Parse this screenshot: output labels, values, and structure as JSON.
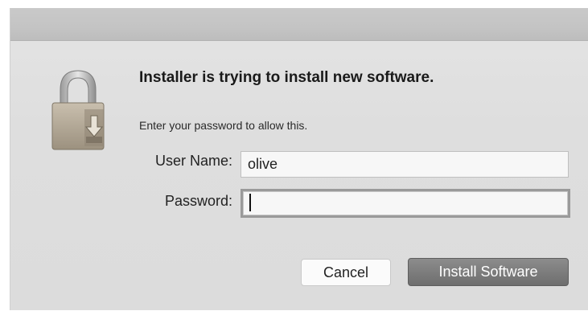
{
  "dialog": {
    "title": "Installer is trying to install new software.",
    "message": "Enter your password to allow this."
  },
  "icons": {
    "lock": "padlock-icon"
  },
  "form": {
    "username_label": "User Name:",
    "username_value": "olive",
    "password_label": "Password:",
    "password_value": ""
  },
  "buttons": {
    "cancel_label": "Cancel",
    "install_label": "Install Software"
  },
  "colors": {
    "dialog_background": "#dedede",
    "titlebar_background": "#c6c6c6",
    "primary_button": "#777777",
    "secondary_button": "#fbfbfb"
  }
}
